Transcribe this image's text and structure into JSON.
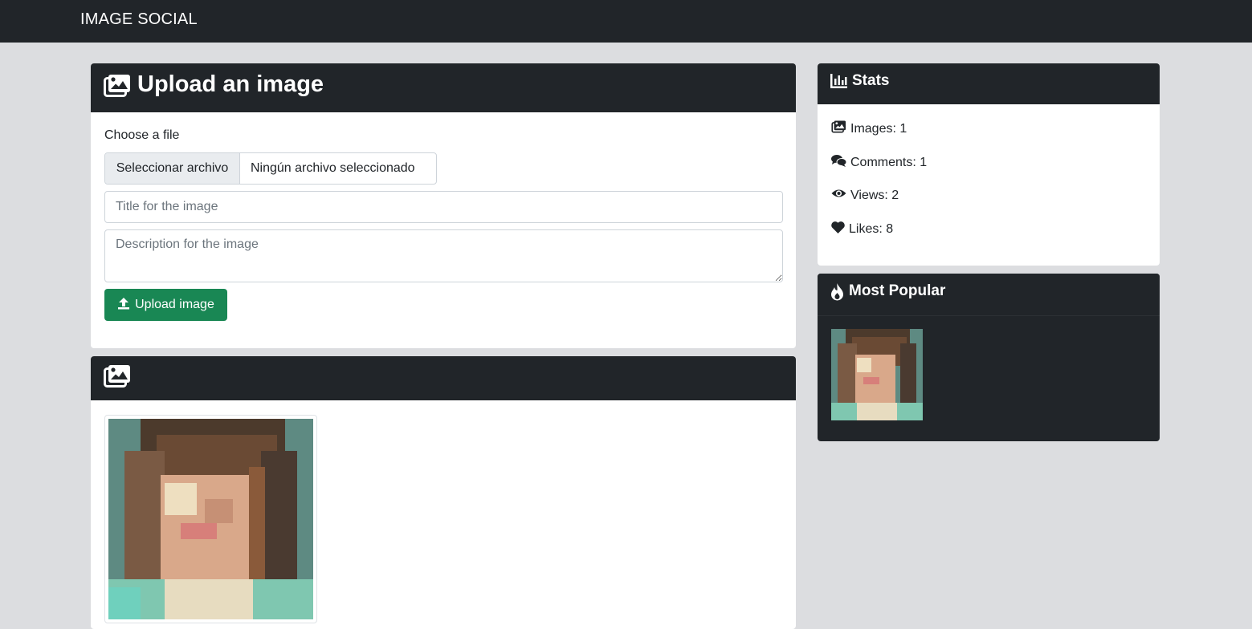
{
  "navbar": {
    "brand": "IMAGE SOCIAL"
  },
  "upload": {
    "title": "Upload an image",
    "choose_label": "Choose a file",
    "file_button": "Seleccionar archivo",
    "file_status": "Ningún archivo seleccionado",
    "title_placeholder": "Title for the image",
    "description_placeholder": "Description for the image",
    "submit_label": "Upload image"
  },
  "stats": {
    "title": "Stats",
    "images": "Images: 1",
    "comments": "Comments: 1",
    "views": "Views: 2",
    "likes": "Likes: 8"
  },
  "popular": {
    "title": "Most Popular"
  },
  "icons": {
    "upload_header": "images-icon",
    "gallery_header": "images-icon",
    "upload_button": "upload-icon",
    "stats": "bar-chart-icon",
    "images": "images-icon",
    "comments": "comments-icon",
    "views": "eye-icon",
    "likes": "heart-icon",
    "popular": "fire-icon"
  },
  "colors": {
    "navbar": "#212529",
    "page_bg": "#dcdde0",
    "success": "#198754"
  }
}
